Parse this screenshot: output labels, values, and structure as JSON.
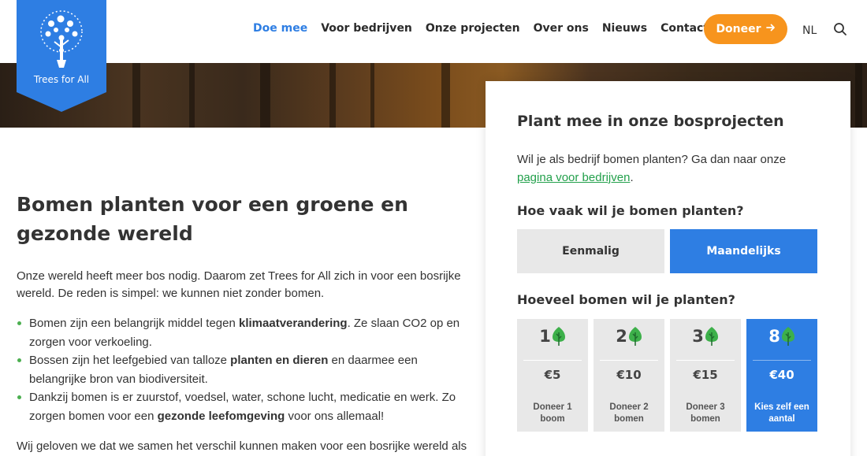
{
  "logo": {
    "text": "Trees for All"
  },
  "nav": {
    "items": [
      "Doe mee",
      "Voor bedrijven",
      "Onze projecten",
      "Over ons",
      "Nieuws",
      "Contact"
    ],
    "donate_label": "Doneer",
    "language": "NL"
  },
  "main": {
    "title": "Bomen planten voor een groene en gezonde wereld",
    "intro": "Onze wereld heeft meer bos nodig. Daarom zet Trees for All zich in voor een bosrijke wereld. De reden is simpel: we kunnen niet zonder bomen.",
    "bullets": [
      {
        "a": "Bomen zijn een belangrijk middel tegen ",
        "b": "klimaatverandering",
        "c": ". Ze slaan CO2 op en zorgen voor verkoeling."
      },
      {
        "a": "Bossen zijn het leefgebied van talloze ",
        "b": "planten en dieren",
        "c": " en daarmee een belangrijke bron van biodiversiteit."
      },
      {
        "a": "Dankzij bomen is er zuurstof, voedsel, water, schone lucht, medicatie en werk. Zo zorgen bomen voor een ",
        "b": "gezonde leefomgeving",
        "c": " voor ons allemaal!"
      }
    ],
    "closing": "Wij geloven we dat we samen het verschil kunnen maken voor een bosrijke wereld als"
  },
  "card": {
    "title": "Plant mee in onze bosprojecten",
    "text_before": "Wil je als bedrijf bomen planten? Ga dan naar onze ",
    "link": "pagina voor bedrijven",
    "text_after": ".",
    "q_frequency": "Hoe vaak wil je bomen planten?",
    "frequency": [
      "Eenmalig",
      "Maandelijks"
    ],
    "q_amount": "Hoeveel bomen wil je planten?",
    "options": [
      {
        "count": "1",
        "price": "€5",
        "label": "Doneer 1 boom"
      },
      {
        "count": "2",
        "price": "€10",
        "label": "Doneer 2 bomen"
      },
      {
        "count": "3",
        "price": "€15",
        "label": "Doneer 3 bomen"
      },
      {
        "count": "8",
        "price": "€40",
        "label": "Kies zelf een aantal"
      }
    ]
  },
  "colors": {
    "accent": "#2e7ee3",
    "donate": "#f7941d",
    "link": "#22a04b",
    "tree": "#3db04a"
  }
}
